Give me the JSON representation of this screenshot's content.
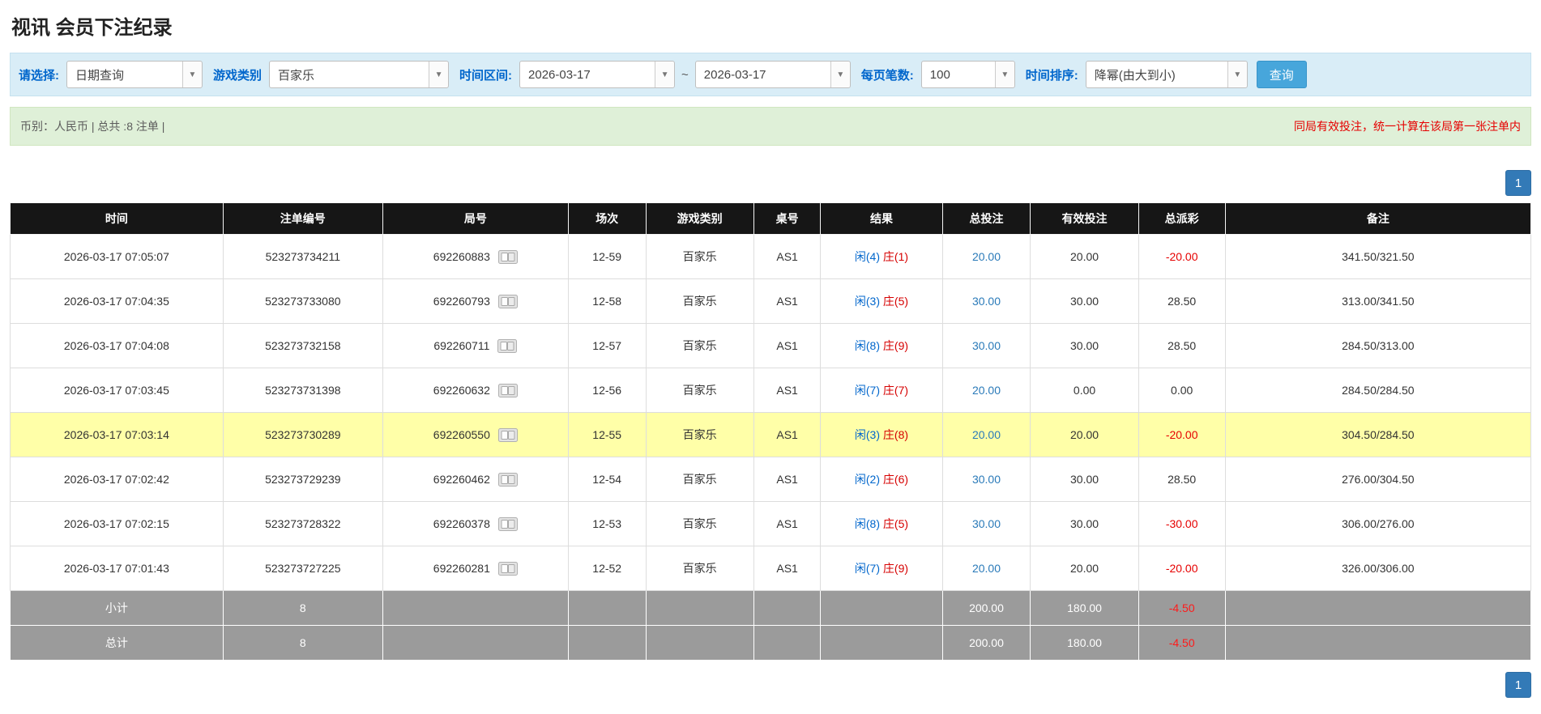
{
  "page": {
    "title": "视讯 会员下注纪录"
  },
  "colors": {
    "accent_blue": "#337ab7",
    "filter_bar_bg": "#d9edf7",
    "info_bar_bg": "#dff0d8",
    "header_bg": "#161616",
    "highlight_row": "#ffffa8",
    "negative_red": "#e60000",
    "player_blue": "#0066cc",
    "banker_red": "#d60000"
  },
  "filters": {
    "select_label": "请选择:",
    "query_type_value": "日期查询",
    "game_category_label": "游戏类别",
    "game_category_value": "百家乐",
    "time_range_label": "时间区间:",
    "date_from": "2026-03-17",
    "range_separator": "~",
    "date_to": "2026-03-17",
    "page_size_label": "每页笔数:",
    "page_size_value": "100",
    "time_sort_label": "时间排序:",
    "time_sort_value": "降幂(由大到小)",
    "search_button_label": "查询"
  },
  "info_bar": {
    "summary": "币别：人民币 | 总共 :8 注单 |",
    "notice": "同局有效投注，统一计算在该局第一张注单内"
  },
  "pagination": {
    "current_page": "1"
  },
  "table": {
    "headers": [
      "时间",
      "注单编号",
      "局号",
      "场次",
      "游戏类别",
      "桌号",
      "结果",
      "总投注",
      "有效投注",
      "总派彩",
      "备注"
    ],
    "rows": [
      {
        "time": "2026-03-17 07:05:07",
        "bet_id": "523273734211",
        "round_id": "692260883",
        "session": "12-59",
        "game": "百家乐",
        "table_no": "AS1",
        "result_player": "闲(4)",
        "result_banker": "庄(1)",
        "total_bet": "20.00",
        "valid_bet": "20.00",
        "payout": "-20.00",
        "remark": "341.50/321.50",
        "highlighted": false
      },
      {
        "time": "2026-03-17 07:04:35",
        "bet_id": "523273733080",
        "round_id": "692260793",
        "session": "12-58",
        "game": "百家乐",
        "table_no": "AS1",
        "result_player": "闲(3)",
        "result_banker": "庄(5)",
        "total_bet": "30.00",
        "valid_bet": "30.00",
        "payout": "28.50",
        "remark": "313.00/341.50",
        "highlighted": false
      },
      {
        "time": "2026-03-17 07:04:08",
        "bet_id": "523273732158",
        "round_id": "692260711",
        "session": "12-57",
        "game": "百家乐",
        "table_no": "AS1",
        "result_player": "闲(8)",
        "result_banker": "庄(9)",
        "total_bet": "30.00",
        "valid_bet": "30.00",
        "payout": "28.50",
        "remark": "284.50/313.00",
        "highlighted": false
      },
      {
        "time": "2026-03-17 07:03:45",
        "bet_id": "523273731398",
        "round_id": "692260632",
        "session": "12-56",
        "game": "百家乐",
        "table_no": "AS1",
        "result_player": "闲(7)",
        "result_banker": "庄(7)",
        "total_bet": "20.00",
        "valid_bet": "0.00",
        "payout": "0.00",
        "remark": "284.50/284.50",
        "highlighted": false
      },
      {
        "time": "2026-03-17 07:03:14",
        "bet_id": "523273730289",
        "round_id": "692260550",
        "session": "12-55",
        "game": "百家乐",
        "table_no": "AS1",
        "result_player": "闲(3)",
        "result_banker": "庄(8)",
        "total_bet": "20.00",
        "valid_bet": "20.00",
        "payout": "-20.00",
        "remark": "304.50/284.50",
        "highlighted": true
      },
      {
        "time": "2026-03-17 07:02:42",
        "bet_id": "523273729239",
        "round_id": "692260462",
        "session": "12-54",
        "game": "百家乐",
        "table_no": "AS1",
        "result_player": "闲(2)",
        "result_banker": "庄(6)",
        "total_bet": "30.00",
        "valid_bet": "30.00",
        "payout": "28.50",
        "remark": "276.00/304.50",
        "highlighted": false
      },
      {
        "time": "2026-03-17 07:02:15",
        "bet_id": "523273728322",
        "round_id": "692260378",
        "session": "12-53",
        "game": "百家乐",
        "table_no": "AS1",
        "result_player": "闲(8)",
        "result_banker": "庄(5)",
        "total_bet": "30.00",
        "valid_bet": "30.00",
        "payout": "-30.00",
        "remark": "306.00/276.00",
        "highlighted": false
      },
      {
        "time": "2026-03-17 07:01:43",
        "bet_id": "523273727225",
        "round_id": "692260281",
        "session": "12-52",
        "game": "百家乐",
        "table_no": "AS1",
        "result_player": "闲(7)",
        "result_banker": "庄(9)",
        "total_bet": "20.00",
        "valid_bet": "20.00",
        "payout": "-20.00",
        "remark": "326.00/306.00",
        "highlighted": false
      }
    ],
    "subtotal": {
      "label": "小计",
      "count": "8",
      "total_bet": "200.00",
      "valid_bet": "180.00",
      "payout": "-4.50"
    },
    "total": {
      "label": "总计",
      "count": "8",
      "total_bet": "200.00",
      "valid_bet": "180.00",
      "payout": "-4.50"
    }
  }
}
